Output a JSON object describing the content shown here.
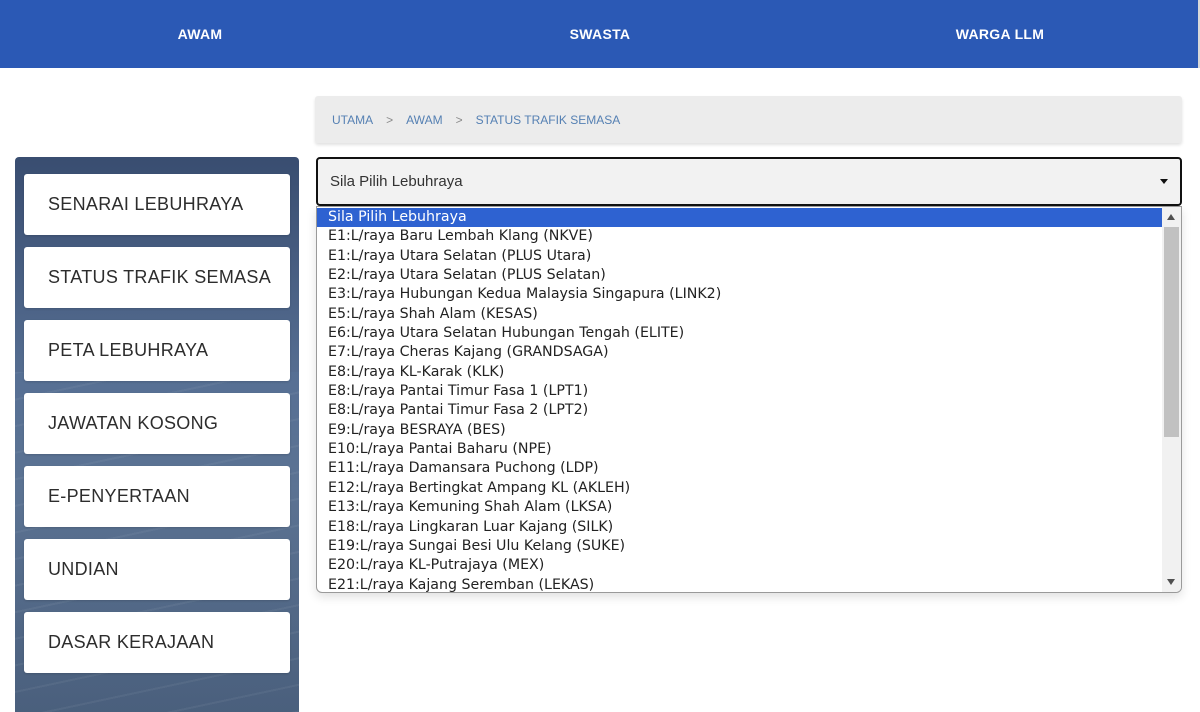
{
  "topnav": {
    "items": [
      {
        "label": "AWAM"
      },
      {
        "label": "SWASTA"
      },
      {
        "label": "WARGA LLM"
      }
    ]
  },
  "sidebar": {
    "items": [
      {
        "label": "SENARAI LEBUHRAYA"
      },
      {
        "label": "STATUS TRAFIK SEMASA"
      },
      {
        "label": "PETA LEBUHRAYA"
      },
      {
        "label": "JAWATAN KOSONG"
      },
      {
        "label": "E-PENYERTAAN"
      },
      {
        "label": "UNDIAN"
      },
      {
        "label": "DASAR KERAJAAN"
      }
    ]
  },
  "breadcrumb": {
    "items": [
      "UTAMA",
      "AWAM",
      "STATUS TRAFIK SEMASA"
    ],
    "separator": ">"
  },
  "highway_select": {
    "selected_value": "Sila Pilih Lebuhraya",
    "options": [
      "Sila Pilih Lebuhraya",
      "E1:L/raya Baru Lembah Klang (NKVE)",
      "E1:L/raya Utara Selatan (PLUS Utara)",
      "E2:L/raya Utara Selatan (PLUS Selatan)",
      "E3:L/raya Hubungan Kedua Malaysia Singapura (LINK2)",
      "E5:L/raya Shah Alam (KESAS)",
      "E6:L/raya Utara Selatan Hubungan Tengah (ELITE)",
      "E7:L/raya Cheras Kajang (GRANDSAGA)",
      "E8:L/raya KL-Karak (KLK)",
      "E8:L/raya Pantai Timur Fasa 1 (LPT1)",
      "E8:L/raya Pantai Timur Fasa 2 (LPT2)",
      "E9:L/raya BESRAYA (BES)",
      "E10:L/raya Pantai Baharu (NPE)",
      "E11:L/raya Damansara Puchong (LDP)",
      "E12:L/raya Bertingkat Ampang KL (AKLEH)",
      "E13:L/raya Kemuning Shah Alam (LKSA)",
      "E18:L/raya Lingkaran Luar Kajang (SILK)",
      "E19:L/raya Sungai Besi Ulu Kelang (SUKE)",
      "E20:L/raya KL-Putrajaya (MEX)",
      "E21:L/raya Kajang Seremban (LEKAS)"
    ],
    "highlighted_index": 0
  },
  "colors": {
    "topbar": "#2b59b5",
    "highlight": "#2e62d1",
    "breadcrumb_link": "#5580b3"
  }
}
